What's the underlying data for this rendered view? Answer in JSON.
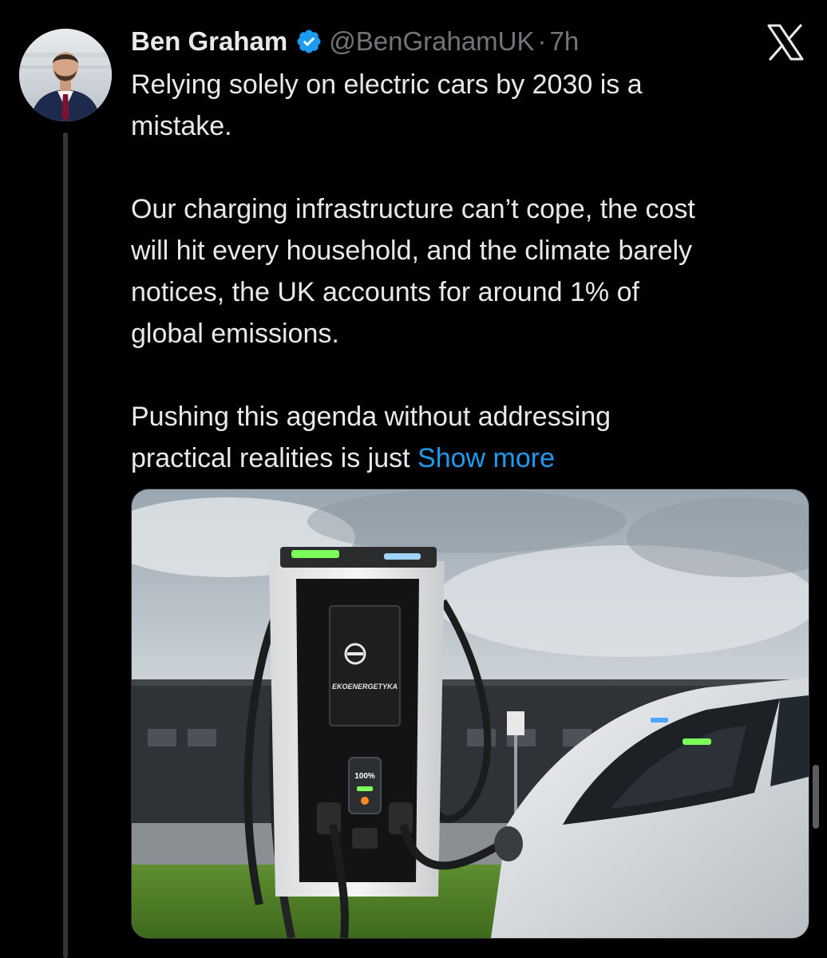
{
  "author": {
    "display_name": "Ben Graham",
    "handle": "@BenGrahamUK",
    "separator": "·",
    "time": "7h"
  },
  "icons": {
    "verified": "verified-badge-icon",
    "brand": "x-logo-icon"
  },
  "tweet": {
    "text": "Relying solely on electric cars by 2030 is a\nmistake.\n\nOur charging infrastructure can’t cope, the cost\nwill hit every household, and the climate barely\nnotices, the UK accounts for around 1% of\nglobal emissions.\n\nPushing this agenda without addressing\npractical realities is just ",
    "show_more": "Show more"
  },
  "media": {
    "charger_brand": "EKOENERGETYKA",
    "charge_level": "100%"
  },
  "colors": {
    "background": "#000000",
    "text": "#e7e9ea",
    "secondary": "#71767b",
    "link": "#1d9bf0",
    "verified": "#1d9bf0"
  }
}
